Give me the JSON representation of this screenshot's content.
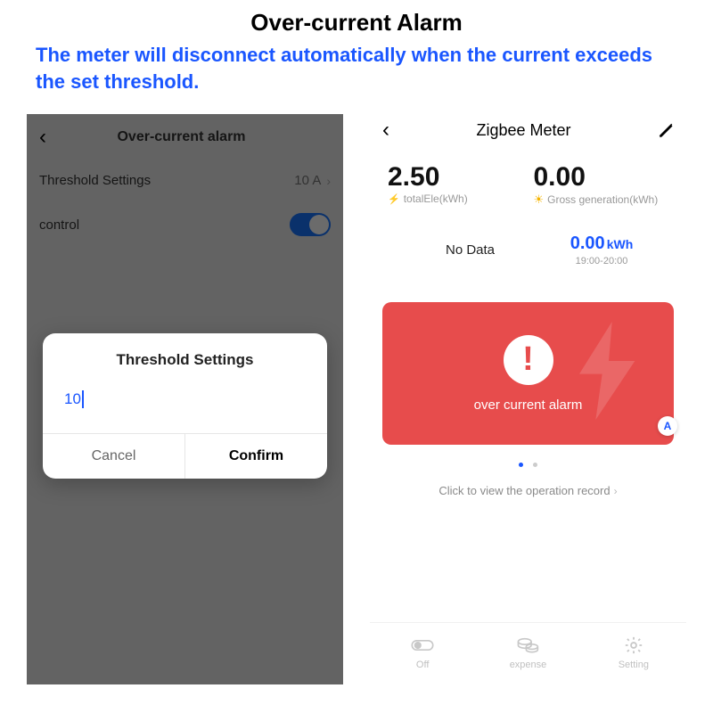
{
  "header": {
    "title": "Over-current Alarm",
    "subtitle": "The meter will disconnect automatically when the current exceeds the set threshold."
  },
  "left": {
    "screen_title": "Over-current alarm",
    "threshold_label": "Threshold Settings",
    "threshold_value": "10 A",
    "control_label": "control",
    "control_state": true,
    "dialog": {
      "title": "Threshold Settings",
      "value": "10",
      "cancel": "Cancel",
      "confirm": "Confirm"
    }
  },
  "right": {
    "title": "Zigbee Meter",
    "stats": [
      {
        "value": "2.50",
        "icon": "bolt",
        "label": "totalEle(kWh)"
      },
      {
        "value": "0.00",
        "icon": "sun",
        "label": "Gross generation(kWh)"
      }
    ],
    "nodata": "No Data",
    "period_value": "0.00",
    "period_unit": "kWh",
    "period_range": "19:00-20:00",
    "alarm_text": "over current alarm",
    "badge": "A",
    "op_record": "Click to view the operation record",
    "bottom": [
      {
        "label": "Off",
        "icon": "toggle"
      },
      {
        "label": "expense",
        "icon": "coins"
      },
      {
        "label": "Setting",
        "icon": "gear"
      }
    ]
  }
}
